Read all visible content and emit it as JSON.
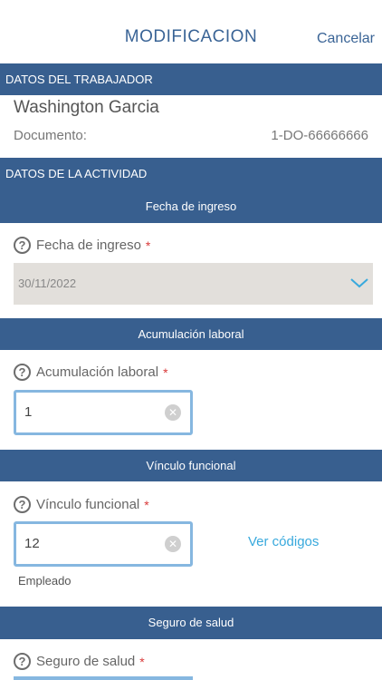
{
  "header": {
    "title": "MODIFICACION",
    "cancel_label": "Cancelar"
  },
  "worker_section": {
    "title": "DATOS DEL TRABAJADOR",
    "name": "Washington Garcia",
    "document_label": "Documento:",
    "document_value": "1-DO-66666666"
  },
  "activity_section": {
    "title": "DATOS DE LA ACTIVIDAD"
  },
  "fecha_ingreso": {
    "section_title": "Fecha de ingreso",
    "label": "Fecha de ingreso",
    "required": "*",
    "value": "30/11/2022"
  },
  "acumulacion": {
    "section_title": "Acumulación laboral",
    "label": "Acumulación laboral",
    "required": "*",
    "value": "1"
  },
  "vinculo": {
    "section_title": "Vínculo funcional",
    "label": "Vínculo funcional",
    "required": "*",
    "value": "12",
    "link_label": "Ver códigos",
    "helper": "Empleado"
  },
  "seguro": {
    "section_title": "Seguro de salud",
    "label": "Seguro de salud",
    "required": "*"
  },
  "icons": {
    "help": "question-circle-icon",
    "clear": "clear-circle-icon",
    "chevron": "chevron-down-icon"
  },
  "colors": {
    "section_bar": "#385f8f",
    "accent": "#3a6496",
    "link": "#38a9dd",
    "input_border": "#86b7e0",
    "required": "#d93a3a"
  }
}
